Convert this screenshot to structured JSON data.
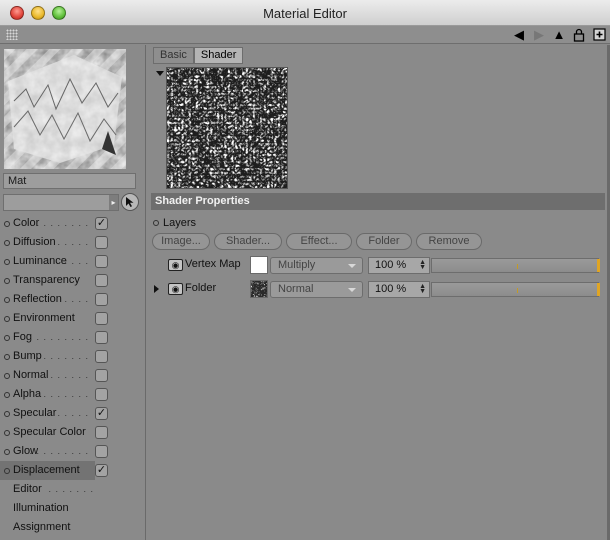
{
  "window": {
    "title": "Material Editor"
  },
  "toolbar": {
    "icons": [
      "back-arrow-icon",
      "forward-arrow-icon",
      "cursor-up-icon",
      "lock-icon",
      "new-window-icon"
    ]
  },
  "material": {
    "name": "Mat"
  },
  "channels": [
    {
      "label": "Color",
      "leader": ". . . . . . . .",
      "checked": true,
      "active": false
    },
    {
      "label": "Diffusion",
      "leader": ". . . . .",
      "checked": false,
      "active": false
    },
    {
      "label": "Luminance",
      "leader": ". . . .",
      "checked": false,
      "active": false
    },
    {
      "label": "Transparency",
      "leader": "",
      "checked": false,
      "active": false
    },
    {
      "label": "Reflection",
      "leader": ". . . .",
      "checked": false,
      "active": false
    },
    {
      "label": "Environment",
      "leader": "",
      "checked": false,
      "active": false
    },
    {
      "label": "Fog",
      "leader": ". . . . . . . . . .",
      "checked": false,
      "active": false
    },
    {
      "label": "Bump",
      "leader": ". . . . . . . .",
      "checked": false,
      "active": false
    },
    {
      "label": "Normal",
      "leader": ". . . . . . .",
      "checked": false,
      "active": false
    },
    {
      "label": "Alpha",
      "leader": ". . . . . . . .",
      "checked": false,
      "active": false
    },
    {
      "label": "Specular",
      "leader": ". . . . .",
      "checked": true,
      "active": false
    },
    {
      "label": "Specular Color",
      "leader": "",
      "checked": false,
      "active": false
    },
    {
      "label": "Glow",
      "leader": ". . . . . . . . .",
      "checked": false,
      "active": false
    },
    {
      "label": "Displacement",
      "leader": "",
      "checked": true,
      "active": true
    },
    {
      "label": "Editor",
      "leader": ". . . . . . .",
      "checked": null,
      "active": false
    },
    {
      "label": "Illumination",
      "leader": "",
      "checked": null,
      "active": false
    },
    {
      "label": "Assignment",
      "leader": "",
      "checked": null,
      "active": false
    }
  ],
  "tabs": [
    {
      "label": "Basic",
      "selected": false
    },
    {
      "label": "Shader",
      "selected": true
    }
  ],
  "section": {
    "title": "Shader Properties",
    "layers_label": "Layers"
  },
  "buttons": [
    "Image...",
    "Shader...",
    "Effect...",
    "Folder",
    "Remove"
  ],
  "layers": [
    {
      "name": "Vertex Map",
      "blend": "Multiply",
      "opacity": "100 %",
      "opacity_value": 100,
      "expandable": false,
      "thumb": "white"
    },
    {
      "name": "Folder",
      "blend": "Normal",
      "opacity": "100 %",
      "opacity_value": 100,
      "expandable": true,
      "thumb": "noise"
    }
  ],
  "colors": {
    "slider_knob": "#e0a524",
    "window_bg": "#8a8a8a",
    "section_header": "#6e6e6e"
  }
}
